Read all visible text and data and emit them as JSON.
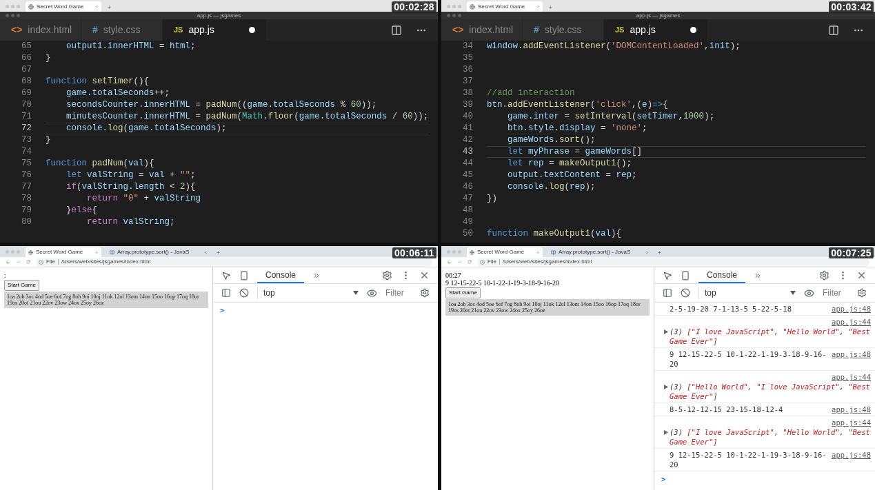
{
  "panes": [
    {
      "kind": "editor",
      "timestamp": "00:02:28",
      "browser_tab": "Secret Word Game",
      "window_title": "app.js — jsgames",
      "tabs": [
        {
          "label": "index.html",
          "glyph": "<>",
          "kind": "html",
          "selected": false,
          "modified": false
        },
        {
          "label": "style.css",
          "glyph": "#",
          "kind": "css",
          "selected": false,
          "modified": false
        },
        {
          "label": "app.js",
          "glyph": "JS",
          "kind": "js",
          "selected": true,
          "modified": true
        }
      ],
      "lines": [
        {
          "number": "65",
          "current": false,
          "tokens": [
            {
              "text": "    output1.innerHTML",
              "kind": "var"
            },
            {
              "text": " = ",
              "kind": "p"
            },
            {
              "text": "html",
              "kind": "var"
            },
            {
              "text": ";",
              "kind": "p"
            }
          ]
        },
        {
          "number": "66",
          "current": false,
          "tokens": [
            {
              "text": "}",
              "kind": "p"
            }
          ]
        },
        {
          "number": "67",
          "current": false
        },
        {
          "number": "68",
          "current": false,
          "tokens": [
            {
              "text": "function ",
              "kind": "kw"
            },
            {
              "text": "setTimer",
              "kind": "fn"
            },
            {
              "text": "(){",
              "kind": "p"
            }
          ]
        },
        {
          "number": "69",
          "current": false,
          "tokens": [
            {
              "text": "    game.totalSeconds",
              "kind": "var"
            },
            {
              "text": "++;",
              "kind": "p"
            }
          ]
        },
        {
          "number": "70",
          "current": false,
          "tokens": [
            {
              "text": "    secondsCounter.innerHTML",
              "kind": "var"
            },
            {
              "text": " = ",
              "kind": "p"
            },
            {
              "text": "padNum",
              "kind": "fn"
            },
            {
              "text": "((",
              "kind": "p"
            },
            {
              "text": "game.totalSeconds",
              "kind": "var"
            },
            {
              "text": " % ",
              "kind": "p"
            },
            {
              "text": "60",
              "kind": "num"
            },
            {
              "text": "));",
              "kind": "p"
            }
          ]
        },
        {
          "number": "71",
          "current": false,
          "tokens": [
            {
              "text": "    minutesCounter.innerHTML",
              "kind": "var"
            },
            {
              "text": " = ",
              "kind": "p"
            },
            {
              "text": "padNum",
              "kind": "fn"
            },
            {
              "text": "(",
              "kind": "p"
            },
            {
              "text": "Math",
              "kind": "type"
            },
            {
              "text": ".",
              "kind": "p"
            },
            {
              "text": "floor",
              "kind": "fn"
            },
            {
              "text": "(",
              "kind": "p"
            },
            {
              "text": "game.totalSeconds",
              "kind": "var"
            },
            {
              "text": " / ",
              "kind": "p"
            },
            {
              "text": "60",
              "kind": "num"
            },
            {
              "text": "));",
              "kind": "p"
            }
          ]
        },
        {
          "number": "72",
          "current": true,
          "tokens": [
            {
              "text": "    console",
              "kind": "var"
            },
            {
              "text": ".",
              "kind": "p"
            },
            {
              "text": "log",
              "kind": "fn"
            },
            {
              "text": "(",
              "kind": "p"
            },
            {
              "text": "game.totalSeconds",
              "kind": "var"
            },
            {
              "text": ");",
              "kind": "p"
            }
          ]
        },
        {
          "number": "73",
          "current": false,
          "tokens": [
            {
              "text": "}",
              "kind": "p"
            }
          ]
        },
        {
          "number": "74",
          "current": false
        },
        {
          "number": "75",
          "current": false,
          "tokens": [
            {
              "text": "function ",
              "kind": "kw"
            },
            {
              "text": "padNum",
              "kind": "fn"
            },
            {
              "text": "(",
              "kind": "p"
            },
            {
              "text": "val",
              "kind": "var"
            },
            {
              "text": "){",
              "kind": "p"
            }
          ]
        },
        {
          "number": "76",
          "current": false,
          "tokens": [
            {
              "text": "    let ",
              "kind": "kw"
            },
            {
              "text": "valString",
              "kind": "var"
            },
            {
              "text": " = ",
              "kind": "p"
            },
            {
              "text": "val",
              "kind": "var"
            },
            {
              "text": " + ",
              "kind": "p"
            },
            {
              "text": "\"\"",
              "kind": "str"
            },
            {
              "text": ";",
              "kind": "p"
            }
          ]
        },
        {
          "number": "77",
          "current": false,
          "tokens": [
            {
              "text": "    if",
              "kind": "ctl"
            },
            {
              "text": "(",
              "kind": "p"
            },
            {
              "text": "valString.length",
              "kind": "var"
            },
            {
              "text": " < ",
              "kind": "p"
            },
            {
              "text": "2",
              "kind": "num"
            },
            {
              "text": "){",
              "kind": "p"
            }
          ]
        },
        {
          "number": "78",
          "current": false,
          "tokens": [
            {
              "text": "        return ",
              "kind": "ctl"
            },
            {
              "text": "\"0\"",
              "kind": "str"
            },
            {
              "text": " + ",
              "kind": "p"
            },
            {
              "text": "valString",
              "kind": "var"
            }
          ]
        },
        {
          "number": "79",
          "current": false,
          "tokens": [
            {
              "text": "    }",
              "kind": "p"
            },
            {
              "text": "else",
              "kind": "ctl"
            },
            {
              "text": "{",
              "kind": "p"
            }
          ]
        },
        {
          "number": "80",
          "current": false,
          "tokens": [
            {
              "text": "        return ",
              "kind": "ctl"
            },
            {
              "text": "valString",
              "kind": "var"
            },
            {
              "text": ";",
              "kind": "p"
            }
          ]
        }
      ]
    },
    {
      "kind": "editor",
      "timestamp": "00:03:42",
      "browser_tab": "Secret Word Game",
      "window_title": "app.js — jsgames",
      "tabs": [
        {
          "label": "index.html",
          "glyph": "<>",
          "kind": "html",
          "selected": false,
          "modified": false
        },
        {
          "label": "style.css",
          "glyph": "#",
          "kind": "css",
          "selected": false,
          "modified": false
        },
        {
          "label": "app.js",
          "glyph": "JS",
          "kind": "js",
          "selected": true,
          "modified": true
        }
      ],
      "lines": [
        {
          "number": "34",
          "current": false,
          "tokens": [
            {
              "text": "window",
              "kind": "var"
            },
            {
              "text": ".",
              "kind": "p"
            },
            {
              "text": "addEventListener",
              "kind": "fn"
            },
            {
              "text": "(",
              "kind": "p"
            },
            {
              "text": "'DOMContentLoaded'",
              "kind": "str"
            },
            {
              "text": ",",
              "kind": "p"
            },
            {
              "text": "init",
              "kind": "var"
            },
            {
              "text": ");",
              "kind": "p"
            }
          ]
        },
        {
          "number": "35",
          "current": false
        },
        {
          "number": "36",
          "current": false
        },
        {
          "number": "37",
          "current": false
        },
        {
          "number": "38",
          "current": false,
          "tokens": [
            {
              "text": "//add interaction",
              "kind": "cmt"
            }
          ]
        },
        {
          "number": "39",
          "current": false,
          "tokens": [
            {
              "text": "btn",
              "kind": "var"
            },
            {
              "text": ".",
              "kind": "p"
            },
            {
              "text": "addEventListener",
              "kind": "fn"
            },
            {
              "text": "(",
              "kind": "p"
            },
            {
              "text": "'click'",
              "kind": "str"
            },
            {
              "text": ",(",
              "kind": "p"
            },
            {
              "text": "e",
              "kind": "var"
            },
            {
              "text": ")",
              "kind": "p"
            },
            {
              "text": "=>",
              "kind": "kw"
            },
            {
              "text": "{",
              "kind": "p"
            }
          ]
        },
        {
          "number": "40",
          "current": false,
          "tokens": [
            {
              "text": "    game.inter",
              "kind": "var"
            },
            {
              "text": " = ",
              "kind": "p"
            },
            {
              "text": "setInterval",
              "kind": "fn"
            },
            {
              "text": "(",
              "kind": "p"
            },
            {
              "text": "setTimer",
              "kind": "var"
            },
            {
              "text": ",",
              "kind": "p"
            },
            {
              "text": "1000",
              "kind": "num"
            },
            {
              "text": ");",
              "kind": "p"
            }
          ]
        },
        {
          "number": "41",
          "current": false,
          "tokens": [
            {
              "text": "    btn.style.display",
              "kind": "var"
            },
            {
              "text": " = ",
              "kind": "p"
            },
            {
              "text": "'none'",
              "kind": "str"
            },
            {
              "text": ";",
              "kind": "p"
            }
          ]
        },
        {
          "number": "42",
          "current": false,
          "tokens": [
            {
              "text": "    gameWords",
              "kind": "var"
            },
            {
              "text": ".",
              "kind": "p"
            },
            {
              "text": "sort",
              "kind": "fn"
            },
            {
              "text": "();",
              "kind": "p"
            }
          ]
        },
        {
          "number": "43",
          "current": true,
          "tokens": [
            {
              "text": "    let ",
              "kind": "kw"
            },
            {
              "text": "myPhrase",
              "kind": "var"
            },
            {
              "text": " = ",
              "kind": "p"
            },
            {
              "text": "gameWords",
              "kind": "var"
            },
            {
              "text": "[]",
              "kind": "p"
            }
          ]
        },
        {
          "number": "44",
          "current": false,
          "tokens": [
            {
              "text": "    let ",
              "kind": "kw"
            },
            {
              "text": "rep",
              "kind": "var"
            },
            {
              "text": " = ",
              "kind": "p"
            },
            {
              "text": "makeOutput1",
              "kind": "fn"
            },
            {
              "text": "();",
              "kind": "p"
            }
          ]
        },
        {
          "number": "45",
          "current": false,
          "tokens": [
            {
              "text": "    output.textContent",
              "kind": "var"
            },
            {
              "text": " = ",
              "kind": "p"
            },
            {
              "text": "rep",
              "kind": "var"
            },
            {
              "text": ";",
              "kind": "p"
            }
          ]
        },
        {
          "number": "46",
          "current": false,
          "tokens": [
            {
              "text": "    console",
              "kind": "var"
            },
            {
              "text": ".",
              "kind": "p"
            },
            {
              "text": "log",
              "kind": "fn"
            },
            {
              "text": "(",
              "kind": "p"
            },
            {
              "text": "rep",
              "kind": "var"
            },
            {
              "text": ");",
              "kind": "p"
            }
          ]
        },
        {
          "number": "47",
          "current": false,
          "tokens": [
            {
              "text": "})",
              "kind": "p"
            }
          ]
        },
        {
          "number": "48",
          "current": false
        },
        {
          "number": "49",
          "current": false
        },
        {
          "number": "50",
          "current": false,
          "tokens": [
            {
              "text": "function ",
              "kind": "kw"
            },
            {
              "text": "makeOutput1",
              "kind": "fn"
            },
            {
              "text": "(",
              "kind": "p"
            },
            {
              "text": "val",
              "kind": "var"
            },
            {
              "text": "){",
              "kind": "p"
            }
          ]
        }
      ]
    },
    {
      "kind": "browser",
      "timestamp": "00:06:11",
      "tabs": [
        {
          "label": "Secret Word Game",
          "selected": true
        },
        {
          "label": "Array.prototype.sort() - JavaS",
          "selected": false
        }
      ],
      "address": {
        "scheme": "File",
        "path": "/Users/web/sites/jsgames/index.html"
      },
      "page": {
        "timer": ":",
        "button": "Start Game",
        "letters": "1oa 2ob 3oc 4od 5oe 6of 7og 8oh 9oi 10oj 11ok 12ol 13om 14on 15oo 16op 17oq 18or 19os 20ot 21ou 22ov 23ow 24ox 25oy 26oz"
      },
      "devtools": {
        "tabs": [
          {
            "label": "Console",
            "selected": true
          }
        ],
        "context": "top",
        "filter_placeholder": "Filter",
        "prompt": ">"
      }
    },
    {
      "kind": "browser",
      "timestamp": "00:07:25",
      "tabs": [
        {
          "label": "Secret Word Game",
          "selected": true
        },
        {
          "label": "Array.prototype.sort() - JavaS",
          "selected": false
        }
      ],
      "address": {
        "scheme": "File",
        "path": "/Users/web/sites/jsgames/index.html"
      },
      "page": {
        "timer": "00:27",
        "output": "9 12-15-22-5 10-1-22-1-19-3-18-9-16-20",
        "button": "Start Game",
        "letters": "1oa 2ob 3oc 4od 5oe 6of 7og 8oh 9oi 10oj 11ok 12ol 13om 14on 15oo 16op 17oq 18or 19os 20ot 21ou 22ov 23ow 24ox 25oy 26oz"
      },
      "devtools": {
        "tabs": [
          {
            "label": "Console",
            "selected": true
          }
        ],
        "context": "top",
        "filter_placeholder": "Filter",
        "prompt": ">",
        "entries": [
          {
            "kind": "log",
            "text": "2-5-19-20 7-1-13-5 5-22-5-18",
            "source": "app.js:48"
          },
          {
            "kind": "array",
            "count": "(3)",
            "text": "[\"I love JavaScript\", \"Hello World\", \"Best Game Ever\"]",
            "source": "app.js:44"
          },
          {
            "kind": "log",
            "text": "9 12-15-22-5 10-1-22-1-19-3-18-9-16-20",
            "source": "app.js:48"
          },
          {
            "kind": "array",
            "count": "(3)",
            "text": "[\"Hello World\", \"I love JavaScript\", \"Best Game Ever\"]",
            "source": "app.js:44"
          },
          {
            "kind": "log",
            "text": "8-5-12-12-15 23-15-18-12-4",
            "source": "app.js:48"
          },
          {
            "kind": "array",
            "count": "(3)",
            "text": "[\"I love JavaScript\", \"Hello World\", \"Best Game Ever\"]",
            "source": "app.js:44"
          },
          {
            "kind": "log",
            "text": "9 12-15-22-5 10-1-22-1-19-3-18-9-16-20",
            "source": "app.js:48"
          }
        ]
      }
    }
  ]
}
